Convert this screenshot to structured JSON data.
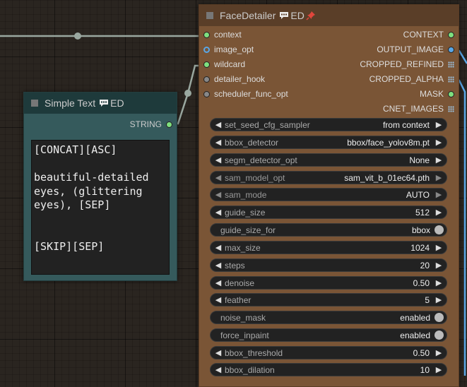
{
  "simple_text": {
    "title": "Simple Text",
    "badge": "ED",
    "output": "STRING",
    "text": "[CONCAT][ASC]\n\nbeautiful-detailed eyes, (glittering eyes), [SEP]\n\n\n[SKIP][SEP]"
  },
  "face_detailer": {
    "title": "FaceDetailer",
    "badge": "ED",
    "inputs": [
      "context",
      "image_opt",
      "wildcard",
      "detailer_hook",
      "scheduler_func_opt"
    ],
    "outputs": [
      "CONTEXT",
      "OUTPUT_IMAGE",
      "CROPPED_REFINED",
      "CROPPED_ALPHA",
      "MASK",
      "CNET_IMAGES"
    ],
    "widgets": [
      {
        "label": "set_seed_cfg_sampler",
        "value": "from context"
      },
      {
        "label": "bbox_detector",
        "value": "bbox/face_yolov8m.pt"
      },
      {
        "label": "segm_detector_opt",
        "value": "None"
      },
      {
        "label": "sam_model_opt",
        "value": "sam_vit_b_01ec64.pth"
      },
      {
        "label": "sam_mode",
        "value": "AUTO"
      },
      {
        "label": "guide_size",
        "value": "512"
      },
      {
        "label": "guide_size_for",
        "value": "bbox"
      },
      {
        "label": "max_size",
        "value": "1024"
      },
      {
        "label": "steps",
        "value": "20"
      },
      {
        "label": "denoise",
        "value": "0.50"
      },
      {
        "label": "feather",
        "value": "5"
      },
      {
        "label": "noise_mask",
        "value": "enabled"
      },
      {
        "label": "force_inpaint",
        "value": "enabled"
      },
      {
        "label": "bbox_threshold",
        "value": "0.50"
      },
      {
        "label": "bbox_dilation",
        "value": "10"
      }
    ]
  },
  "colors": {
    "node_brown": "#7a5536",
    "node_teal": "#355a5c",
    "link_grey": "#9aa8a0",
    "link_blue": "#5aa7e6"
  }
}
